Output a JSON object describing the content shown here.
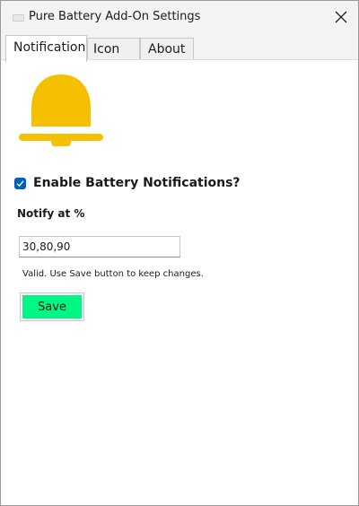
{
  "window": {
    "title": "Pure Battery Add-On Settings",
    "close_icon": "close-icon"
  },
  "tabs": [
    {
      "label": "Notification",
      "selected": true
    },
    {
      "label": "Icon",
      "selected": false
    },
    {
      "label": "About",
      "selected": false
    }
  ],
  "notification": {
    "bell_icon": "bell-icon",
    "bell_color": "#f5c000",
    "enable_label": "Enable Battery Notifications?",
    "enable_checked": true,
    "notify_label": "Notify at %",
    "notify_value": "30,80,90",
    "status_text": "Valid. Use Save button to keep changes.",
    "save_label": "Save",
    "save_color": "#00f783"
  }
}
